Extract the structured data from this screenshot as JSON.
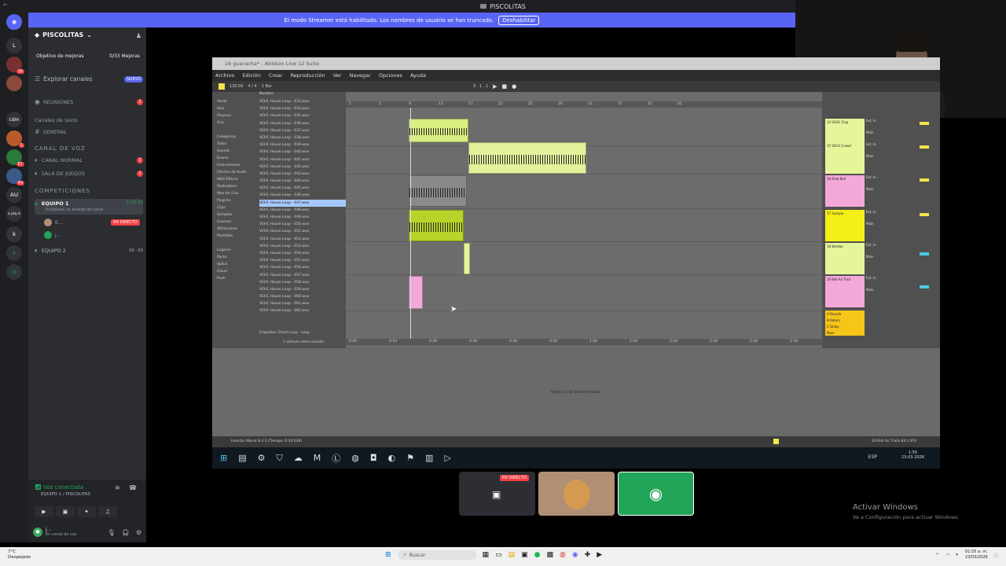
{
  "window": {
    "title": "PISCOLITAS"
  },
  "streamer_banner": {
    "text": "El modo Streamer está habilitado. Los nombres de usuario se han truncado.",
    "button": "Deshabilitar"
  },
  "guilds": [
    {
      "label": "L",
      "badge": ""
    },
    {
      "label": "",
      "badge": "15"
    },
    {
      "label": "",
      "badge": ""
    },
    {
      "label": "cdm",
      "badge": ""
    },
    {
      "label": "",
      "badge": "1"
    },
    {
      "label": "",
      "badge": "67"
    },
    {
      "label": "",
      "badge": "43"
    },
    {
      "label": "AU",
      "badge": ""
    },
    {
      "label": "k.jdq.d",
      "badge": ""
    },
    {
      "label": "k",
      "badge": ""
    }
  ],
  "server": {
    "name": "PISCOLITAS",
    "goal_label": "Objetivo de mejoras",
    "goal_value": "0/33 Mejoras",
    "explore": "Explorar canales",
    "new_badge": "NUEVO",
    "meetings": "REUNIONES",
    "meetings_count": "1",
    "text_category": "Canales de texto",
    "general": "GENERAL",
    "voice_category": "CANAL DE VOZ",
    "normal": "CANAL NORMAL",
    "normal_count": "1",
    "games": "SALA DE JUEGOS",
    "games_count": "1",
    "comp_category": "COMPETICIONES",
    "team1": "EQUIPO 1",
    "team1_time": "6:15:23",
    "team1_status": "Establece un estado de canal",
    "member1": "E...",
    "live": "EN DIRECTO",
    "member2": "j...",
    "team2": "EQUIPO 2",
    "team2_info": "00 : 03"
  },
  "voice": {
    "status": "Voz conectada",
    "where": "EQUIPO 1 / PISCOLITAS"
  },
  "user": {
    "name": "j...",
    "status": "En canal de voz"
  },
  "daw": {
    "window_title": "16 guaracha* - Ableton Live 12 Suite",
    "menu": [
      "Archivo",
      "Edición",
      "Crear",
      "Reproducción",
      "Ver",
      "Navegar",
      "Opciones",
      "Ayuda"
    ],
    "tempo": "130.00",
    "signature": "4 / 4",
    "bar": "1 Bar",
    "position": "9 . 1 . 1",
    "browser_header": "Nombre",
    "sidebar_items": [
      "Verde",
      "Azul",
      "Púrpura",
      "Gris",
      "",
      "Categorías",
      "Todos",
      "Sounds",
      "Drums",
      "Instrumentos",
      "Efectos de Audio",
      "MIDI Effects",
      "Modulators",
      "Max for Live",
      "Plug-Ins",
      "Clips",
      "Samples",
      "Grooves",
      "Afinaciones",
      "Plantillas",
      "",
      "Lugares",
      "Packs",
      "Splice",
      "Cloud",
      "Push"
    ],
    "files": [
      "VEH1 House Loop - 033.wav",
      "VEH1 House Loop - 034.wav",
      "VEH1 House Loop - 035.wav",
      "VEH1 House Loop - 036.wav",
      "VEH1 House Loop - 037.wav",
      "VEH1 House Loop - 038.wav",
      "VEH1 House Loop - 039.wav",
      "VEH1 House Loop - 040.wav",
      "VEH1 House Loop - 041.wav",
      "VEH1 House Loop - 042.wav",
      "VEH1 House Loop - 043.wav",
      "VEH1 House Loop - 044.wav",
      "VEH1 House Loop - 045.wav",
      "VEH1 House Loop - 046.wav",
      "VEH1 House Loop - 047.wav",
      "VEH1 House Loop - 048.wav",
      "VEH1 House Loop - 049.wav",
      "VEH1 House Loop - 050.wav",
      "VEH1 House Loop - 051.wav",
      "VEH1 House Loop - 052.wav",
      "VEH1 House Loop - 053.wav",
      "VEH1 House Loop - 054.wav",
      "VEH1 House Loop - 055.wav",
      "VEH1 House Loop - 056.wav",
      "VEH1 House Loop - 057.wav",
      "VEH1 House Loop - 058.wav",
      "VEH1 House Loop - 059.wav",
      "VEH1 House Loop - 060.wav",
      "VEH1 House Loop - 061.wav",
      "VEH1 House Loop - 062.wav"
    ],
    "selected_index": 14,
    "tags": "Etiquetas: Drum Loop · Loop",
    "selection_count": "1 artículo seleccionado",
    "ruler_bars": [
      "1",
      "5",
      "9",
      "13",
      "17",
      "21",
      "25",
      "29",
      "33",
      "37",
      "41",
      "45"
    ],
    "ruler_times": [
      "0:00",
      "0:10",
      "0:20",
      "0:30",
      "0:40",
      "0:50",
      "1:00",
      "1:10",
      "1:20",
      "1:30",
      "1:40",
      "1:50"
    ],
    "tracks": [
      {
        "name": "14 VEH1 Clap",
        "color": "#e7f59a"
      },
      {
        "name": "15 VEC4 Crowd",
        "color": "#e7f59a"
      },
      {
        "name": "16 Ride Bell",
        "color": "#f3a8d8"
      },
      {
        "name": "17 Sample",
        "color": "#f5ef18"
      },
      {
        "name": "18 Bombo",
        "color": "#e7f59a"
      },
      {
        "name": "19 Roll Air Trail",
        "color": "#f3a8d8"
      }
    ],
    "returns": [
      "A Reverb",
      "B Return",
      "C Delay",
      "Main"
    ],
    "mixer_labels": {
      "ext": "Ext. In",
      "main": "Main"
    },
    "detail_message": "Ningún clip seleccionado.",
    "status_left": "Insertar Marca 8.4.3 (Tiempo: 0:14:638)",
    "status_right": "20-Roll Air Trails Kit's SFX",
    "clock_time": "1:55",
    "clock_date": "23-03-2026",
    "lang": "ESP"
  },
  "thumbs": {
    "live": "EN DIRECTO"
  },
  "activate": {
    "title": "Activar Windows",
    "sub": "Ve a Configuración para activar Windows."
  },
  "taskbar": {
    "weather_temp": "7°C",
    "weather_desc": "Despejado",
    "search": "Buscar",
    "time": "01:55 a. m.",
    "date": "23/03/2026"
  },
  "colors": {
    "blurple": "#5865f2",
    "green": "#23a559",
    "red": "#f23f43"
  }
}
